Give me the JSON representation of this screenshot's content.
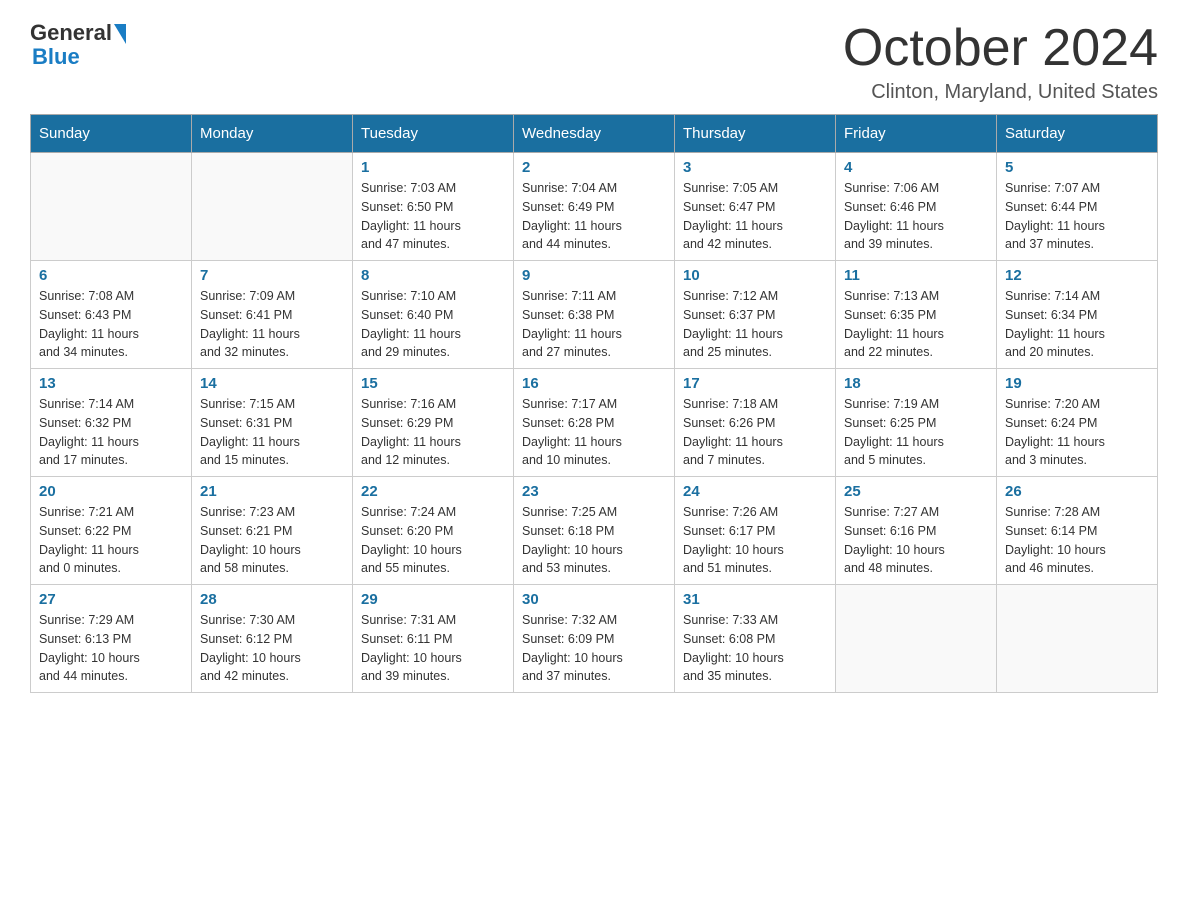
{
  "header": {
    "logo_general": "General",
    "logo_blue": "Blue",
    "month_title": "October 2024",
    "location": "Clinton, Maryland, United States"
  },
  "calendar": {
    "days_of_week": [
      "Sunday",
      "Monday",
      "Tuesday",
      "Wednesday",
      "Thursday",
      "Friday",
      "Saturday"
    ],
    "weeks": [
      [
        {
          "day": "",
          "info": ""
        },
        {
          "day": "",
          "info": ""
        },
        {
          "day": "1",
          "info": "Sunrise: 7:03 AM\nSunset: 6:50 PM\nDaylight: 11 hours\nand 47 minutes."
        },
        {
          "day": "2",
          "info": "Sunrise: 7:04 AM\nSunset: 6:49 PM\nDaylight: 11 hours\nand 44 minutes."
        },
        {
          "day": "3",
          "info": "Sunrise: 7:05 AM\nSunset: 6:47 PM\nDaylight: 11 hours\nand 42 minutes."
        },
        {
          "day": "4",
          "info": "Sunrise: 7:06 AM\nSunset: 6:46 PM\nDaylight: 11 hours\nand 39 minutes."
        },
        {
          "day": "5",
          "info": "Sunrise: 7:07 AM\nSunset: 6:44 PM\nDaylight: 11 hours\nand 37 minutes."
        }
      ],
      [
        {
          "day": "6",
          "info": "Sunrise: 7:08 AM\nSunset: 6:43 PM\nDaylight: 11 hours\nand 34 minutes."
        },
        {
          "day": "7",
          "info": "Sunrise: 7:09 AM\nSunset: 6:41 PM\nDaylight: 11 hours\nand 32 minutes."
        },
        {
          "day": "8",
          "info": "Sunrise: 7:10 AM\nSunset: 6:40 PM\nDaylight: 11 hours\nand 29 minutes."
        },
        {
          "day": "9",
          "info": "Sunrise: 7:11 AM\nSunset: 6:38 PM\nDaylight: 11 hours\nand 27 minutes."
        },
        {
          "day": "10",
          "info": "Sunrise: 7:12 AM\nSunset: 6:37 PM\nDaylight: 11 hours\nand 25 minutes."
        },
        {
          "day": "11",
          "info": "Sunrise: 7:13 AM\nSunset: 6:35 PM\nDaylight: 11 hours\nand 22 minutes."
        },
        {
          "day": "12",
          "info": "Sunrise: 7:14 AM\nSunset: 6:34 PM\nDaylight: 11 hours\nand 20 minutes."
        }
      ],
      [
        {
          "day": "13",
          "info": "Sunrise: 7:14 AM\nSunset: 6:32 PM\nDaylight: 11 hours\nand 17 minutes."
        },
        {
          "day": "14",
          "info": "Sunrise: 7:15 AM\nSunset: 6:31 PM\nDaylight: 11 hours\nand 15 minutes."
        },
        {
          "day": "15",
          "info": "Sunrise: 7:16 AM\nSunset: 6:29 PM\nDaylight: 11 hours\nand 12 minutes."
        },
        {
          "day": "16",
          "info": "Sunrise: 7:17 AM\nSunset: 6:28 PM\nDaylight: 11 hours\nand 10 minutes."
        },
        {
          "day": "17",
          "info": "Sunrise: 7:18 AM\nSunset: 6:26 PM\nDaylight: 11 hours\nand 7 minutes."
        },
        {
          "day": "18",
          "info": "Sunrise: 7:19 AM\nSunset: 6:25 PM\nDaylight: 11 hours\nand 5 minutes."
        },
        {
          "day": "19",
          "info": "Sunrise: 7:20 AM\nSunset: 6:24 PM\nDaylight: 11 hours\nand 3 minutes."
        }
      ],
      [
        {
          "day": "20",
          "info": "Sunrise: 7:21 AM\nSunset: 6:22 PM\nDaylight: 11 hours\nand 0 minutes."
        },
        {
          "day": "21",
          "info": "Sunrise: 7:23 AM\nSunset: 6:21 PM\nDaylight: 10 hours\nand 58 minutes."
        },
        {
          "day": "22",
          "info": "Sunrise: 7:24 AM\nSunset: 6:20 PM\nDaylight: 10 hours\nand 55 minutes."
        },
        {
          "day": "23",
          "info": "Sunrise: 7:25 AM\nSunset: 6:18 PM\nDaylight: 10 hours\nand 53 minutes."
        },
        {
          "day": "24",
          "info": "Sunrise: 7:26 AM\nSunset: 6:17 PM\nDaylight: 10 hours\nand 51 minutes."
        },
        {
          "day": "25",
          "info": "Sunrise: 7:27 AM\nSunset: 6:16 PM\nDaylight: 10 hours\nand 48 minutes."
        },
        {
          "day": "26",
          "info": "Sunrise: 7:28 AM\nSunset: 6:14 PM\nDaylight: 10 hours\nand 46 minutes."
        }
      ],
      [
        {
          "day": "27",
          "info": "Sunrise: 7:29 AM\nSunset: 6:13 PM\nDaylight: 10 hours\nand 44 minutes."
        },
        {
          "day": "28",
          "info": "Sunrise: 7:30 AM\nSunset: 6:12 PM\nDaylight: 10 hours\nand 42 minutes."
        },
        {
          "day": "29",
          "info": "Sunrise: 7:31 AM\nSunset: 6:11 PM\nDaylight: 10 hours\nand 39 minutes."
        },
        {
          "day": "30",
          "info": "Sunrise: 7:32 AM\nSunset: 6:09 PM\nDaylight: 10 hours\nand 37 minutes."
        },
        {
          "day": "31",
          "info": "Sunrise: 7:33 AM\nSunset: 6:08 PM\nDaylight: 10 hours\nand 35 minutes."
        },
        {
          "day": "",
          "info": ""
        },
        {
          "day": "",
          "info": ""
        }
      ]
    ]
  }
}
